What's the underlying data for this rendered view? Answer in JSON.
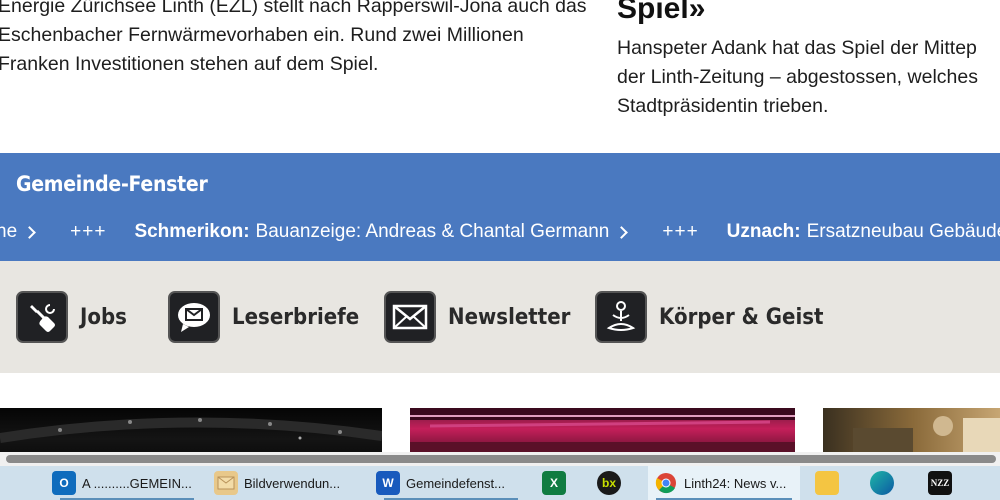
{
  "article_left": {
    "text": "Energie Zürichsee Linth (EZL) stellt nach Rapperswil-Jona auch das Eschenbacher Fernwärmevorhaben ein. Rund zwei Millionen Franken Investitionen stehen auf dem Spiel."
  },
  "article_right": {
    "title_tail": "Spiel»",
    "text": "Hanspeter Adank hat das Spiel der Mittep\nder Linth-Zeitung – abgestossen, welches\nStadtpräsidentin trieben."
  },
  "gemeinde": {
    "title": "Gemeinde-Fenster",
    "ticker": [
      {
        "place": "",
        "text": "ne"
      },
      {
        "place": "Schmerikon:",
        "text": "Bauanzeige: Andreas & Chantal Germann"
      },
      {
        "place": "Uznach:",
        "text": "Ersatzneubau Gebäude"
      }
    ],
    "separator": "+++"
  },
  "links": [
    {
      "label": "Jobs",
      "icon": "hand-wrench-icon"
    },
    {
      "label": "Leserbriefe",
      "icon": "speech-bubble-mail-icon"
    },
    {
      "label": "Newsletter",
      "icon": "envelope-icon"
    },
    {
      "label": "Körper & Geist",
      "icon": "meditation-icon"
    }
  ],
  "taskbar": {
    "items": [
      {
        "label": "A ..........GEMEIN...",
        "icon": "outlook-icon"
      },
      {
        "label": "Bildverwendun...",
        "icon": "mail-icon"
      },
      {
        "label": "Gemeindefenst...",
        "icon": "word-icon"
      },
      {
        "label": "",
        "icon": "excel-icon"
      },
      {
        "label": "",
        "icon": "bexio-icon"
      },
      {
        "label": "Linth24: News v...",
        "icon": "chrome-icon"
      },
      {
        "label": "",
        "icon": "file-explorer-icon"
      },
      {
        "label": "",
        "icon": "edge-icon"
      },
      {
        "label": "NZZ",
        "icon": "nzz-icon"
      }
    ]
  },
  "colors": {
    "gemeinde_bg": "#4a79c0",
    "links_bg": "#e8e6e1",
    "taskbar_bg": "#cfe0ec"
  }
}
